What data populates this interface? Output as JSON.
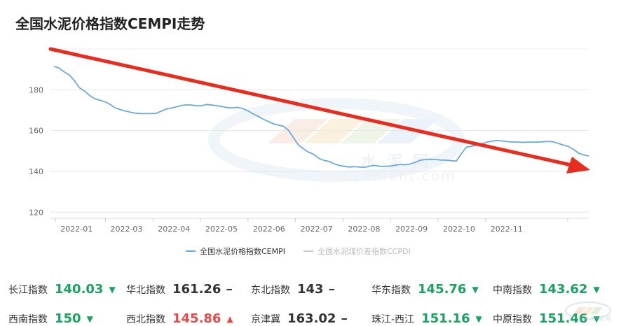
{
  "title": "全国水泥价格指数CEMPI走势",
  "chart_data": {
    "type": "line",
    "xticks": [
      "2022-01",
      "2022-03",
      "2022-04",
      "2022-05",
      "2022-06",
      "2022-07",
      "2022-08",
      "2022-09",
      "2022-10",
      "2022-11"
    ],
    "yticks": [
      120,
      140,
      160,
      180
    ],
    "ylim": [
      117,
      200
    ],
    "grid": true,
    "legend_position": "bottom-center",
    "series": [
      {
        "name": "全国水泥价格指数CEMPI",
        "color": "#6aa8e0",
        "values": [
          191.5,
          190.6,
          188.8,
          187.3,
          184.5,
          181.0,
          179.4,
          177.2,
          175.6,
          174.9,
          174.1,
          172.9,
          171.1,
          170.3,
          169.6,
          169.0,
          168.5,
          168.3,
          168.3,
          168.3,
          168.4,
          169.4,
          170.5,
          171.0,
          171.6,
          172.3,
          172.6,
          172.5,
          172.1,
          172.1,
          172.8,
          172.5,
          172.2,
          171.8,
          171.3,
          171.1,
          171.4,
          170.8,
          169.8,
          168.3,
          167.1,
          165.7,
          164.5,
          163.4,
          162.7,
          162.2,
          160.2,
          156.6,
          152.9,
          151.0,
          149.4,
          148.3,
          146.4,
          145.4,
          144.9,
          143.7,
          142.9,
          142.5,
          142.1,
          142.3,
          142.1,
          142.0,
          142.6,
          142.9,
          142.4,
          142.5,
          142.6,
          143.0,
          143.4,
          143.2,
          143.7,
          144.5,
          145.5,
          145.8,
          145.9,
          145.8,
          145.5,
          145.5,
          145.2,
          145.1,
          148.7,
          151.9,
          152.3,
          152.8,
          153.5,
          154.3,
          154.8,
          155.1,
          154.9,
          154.6,
          154.4,
          154.4,
          154.2,
          154.3,
          154.3,
          154.3,
          154.5,
          154.7,
          154.5,
          153.7,
          152.9,
          152.2,
          150.8,
          148.9,
          148.1,
          147.5
        ]
      },
      {
        "name": "全国水泥煤价差指数CCPDI",
        "color": "#cccccc",
        "values": []
      }
    ]
  },
  "annotation": {
    "type": "arrow",
    "color": "#e82c1f"
  },
  "watermark": {
    "cn": "水 泥 网",
    "en": "Ccement.com"
  },
  "stats": [
    {
      "label": "长江指数",
      "value": "140.03",
      "trend": "down"
    },
    {
      "label": "华北指数",
      "value": "161.26",
      "trend": "flat"
    },
    {
      "label": "东北指数",
      "value": "143",
      "trend": "flat"
    },
    {
      "label": "华东指数",
      "value": "145.76",
      "trend": "down"
    },
    {
      "label": "中南指数",
      "value": "143.62",
      "trend": "down"
    },
    {
      "label": "西南指数",
      "value": "150",
      "trend": "down"
    },
    {
      "label": "西北指数",
      "value": "145.86",
      "trend": "up"
    },
    {
      "label": "京津冀",
      "value": "163.02",
      "trend": "flat"
    },
    {
      "label": "珠江-西江",
      "value": "151.16",
      "trend": "down"
    },
    {
      "label": "中原指数",
      "value": "151.46",
      "trend": "down"
    }
  ],
  "corner_watermark": "水 泥 网"
}
